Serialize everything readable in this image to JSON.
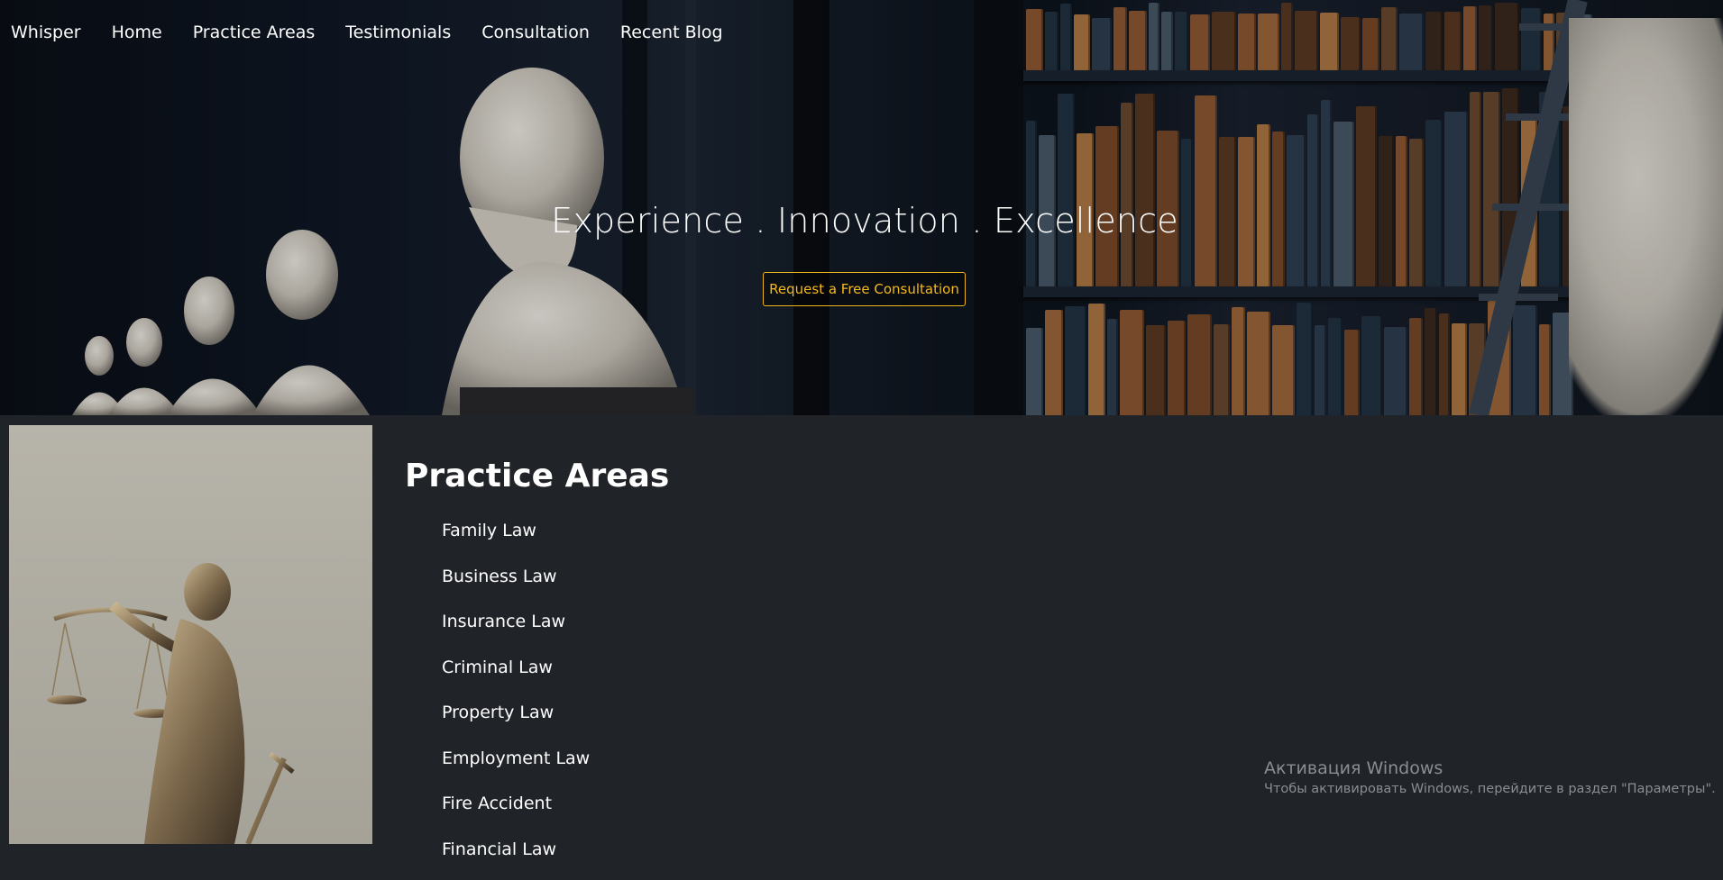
{
  "nav": {
    "items": [
      "Whisper",
      "Home",
      "Practice Areas",
      "Testimonials",
      "Consultation",
      "Recent Blog"
    ]
  },
  "hero": {
    "title": "Experience . Innovation . Excellence",
    "cta_label": "Request a Free Consultation"
  },
  "practice": {
    "title": "Practice Areas",
    "items": [
      "Family Law",
      "Business Law",
      "Insurance Law",
      "Criminal Law",
      "Property Law",
      "Employment Law",
      "Fire Accident",
      "Financial Law"
    ]
  },
  "watermark": {
    "title": "Активация Windows",
    "subtitle": "Чтобы активировать Windows, перейдите в раздел \"Параметры\"."
  },
  "colors": {
    "background": "#202328",
    "accent": "#f5b920",
    "text": "#ffffff"
  }
}
